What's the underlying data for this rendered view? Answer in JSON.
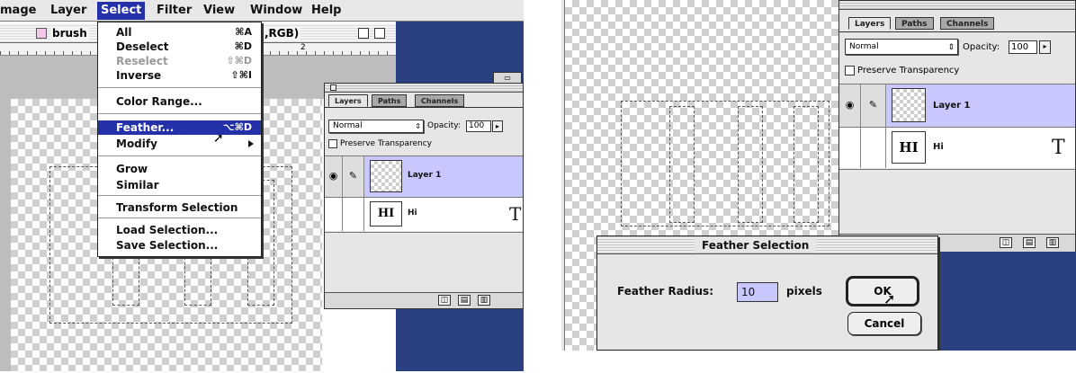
{
  "menubar": {
    "items": [
      {
        "label": "mage"
      },
      {
        "label": "Layer"
      },
      {
        "label": "Select"
      },
      {
        "label": "Filter"
      },
      {
        "label": "View"
      },
      {
        "label": "Window"
      },
      {
        "label": "Help"
      }
    ]
  },
  "document": {
    "title_left": "brush",
    "title_right": ",RGB)",
    "ruler_mark": "2"
  },
  "select_menu": {
    "items": [
      {
        "label": "All",
        "shortcut": "⌘A"
      },
      {
        "label": "Deselect",
        "shortcut": "⌘D"
      },
      {
        "label": "Reselect",
        "shortcut": "⇧⌘D"
      },
      {
        "label": "Inverse",
        "shortcut": "⇧⌘I"
      },
      {
        "label": "Color Range..."
      },
      {
        "label": "Feather...",
        "shortcut": "⌥⌘D"
      },
      {
        "label": "Modify"
      },
      {
        "label": "Grow"
      },
      {
        "label": "Similar"
      },
      {
        "label": "Transform Selection"
      },
      {
        "label": "Load Selection..."
      },
      {
        "label": "Save Selection..."
      }
    ]
  },
  "layers_palette": {
    "tabs": [
      {
        "label": "Layers"
      },
      {
        "label": "Paths"
      },
      {
        "label": "Channels"
      }
    ],
    "blend_mode": "Normal",
    "opacity_label": "Opacity:",
    "opacity_value": "100",
    "preserve_transparency": "Preserve Transparency",
    "layers": [
      {
        "name": "Layer 1"
      },
      {
        "name": "Hi",
        "thumb_text": "HI",
        "type_glyph": "T"
      }
    ]
  },
  "right_palette": {
    "opacity_value": "100"
  },
  "feather_dialog": {
    "title": "Feather Selection",
    "radius_label": "Feather Radius:",
    "radius_value": "10",
    "unit": "pixels",
    "ok_label": "OK",
    "cancel_label": "Cancel"
  },
  "colors": {
    "menu_highlight": "#2431a8",
    "selected_layer": "#c8c8ff",
    "desktop_blue": "#2b4080"
  }
}
